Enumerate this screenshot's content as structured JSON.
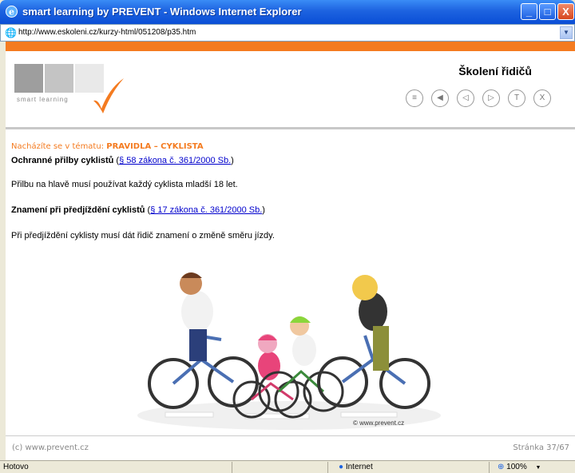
{
  "window": {
    "title": "smart learning by PREVENT - Windows Internet Explorer",
    "minimize_glyph": "_",
    "maximize_glyph": "□",
    "close_glyph": "X"
  },
  "address": {
    "url": "http://www.eskoleni.cz/kurzy-html/051208/p35.htm",
    "dropdown_glyph": "▼"
  },
  "header": {
    "brand": "smart learning",
    "title": "Školení řidičů",
    "nav": [
      {
        "name": "menu",
        "glyph": "≡"
      },
      {
        "name": "first",
        "glyph": "◀"
      },
      {
        "name": "prev",
        "glyph": "◁"
      },
      {
        "name": "next",
        "glyph": "▷"
      },
      {
        "name": "test",
        "glyph": "T"
      },
      {
        "name": "exit",
        "glyph": "X"
      }
    ]
  },
  "breadcrumb": {
    "prefix": "Nacházíte se v tématu:",
    "topic": "PRAVIDLA – CYKLISTA"
  },
  "content": {
    "heading1": "Ochranné přilby cyklistů",
    "link1": "§ 58 zákona č. 361/2000 Sb.",
    "para1": "Přilbu na hlavě musí používat každý cyklista mladší 18 let.",
    "heading2": "Znamení při předjíždění cyklistů",
    "link2": "§ 17 zákona č. 361/2000 Sb.",
    "para2": "Při předjíždění cyklisty musí dát řidič znamení o změně směru jízdy.",
    "open_paren": " (",
    "close_paren": ")"
  },
  "image": {
    "credit": "© www.prevent.cz"
  },
  "footer": {
    "copyright": "(c) www.prevent.cz",
    "page": "Stránka 37/67"
  },
  "status": {
    "text": "Hotovo",
    "zone": "Internet",
    "zoom": "100%",
    "zoom_dropdown": "▼"
  },
  "colors": {
    "accent": "#f47b20",
    "link": "#0000cc",
    "titlebar": "#1d63e0"
  }
}
